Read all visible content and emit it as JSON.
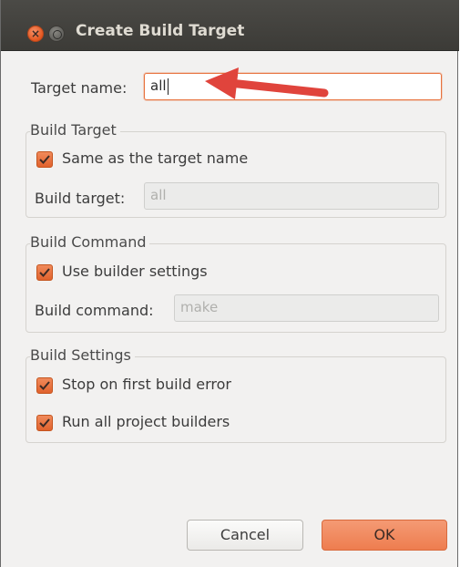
{
  "window": {
    "title": "Create Build Target"
  },
  "target_name": {
    "label": "Target name:",
    "value": "all"
  },
  "build_target_group": {
    "title": "Build Target",
    "same_as_name_label": "Same as the target name",
    "same_as_name_checked": true,
    "build_target_label": "Build target:",
    "build_target_value": "all"
  },
  "build_command_group": {
    "title": "Build Command",
    "use_builder_label": "Use builder settings",
    "use_builder_checked": true,
    "build_command_label": "Build command:",
    "build_command_value": "make"
  },
  "build_settings_group": {
    "title": "Build Settings",
    "stop_on_error_label": "Stop on first build error",
    "stop_on_error_checked": true,
    "run_all_label": "Run all project builders",
    "run_all_checked": true
  },
  "buttons": {
    "cancel": "Cancel",
    "ok": "OK"
  },
  "colors": {
    "accent": "#ee7d4f",
    "titlebar": "#3c3b37",
    "annotation_arrow": "#e0443c"
  }
}
